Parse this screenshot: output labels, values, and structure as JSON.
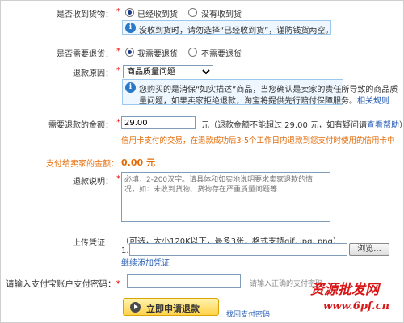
{
  "received_goods": {
    "label": "是否收到货物：",
    "required_mark": "*",
    "options": [
      "已经收到货",
      "没有收到货"
    ],
    "selected_index": 0,
    "tip": "没收到货时，请勿选择“已经收到货”，谨防钱货两空。"
  },
  "need_return": {
    "label": "是否需要退货：",
    "required_mark": "*",
    "options": [
      "我需要退货",
      "不需要退货"
    ],
    "selected_index": 0
  },
  "reason": {
    "label": "退款原因：",
    "required_mark": "*",
    "selected": "商品质量问题",
    "tip_line1": "您购买的是消保“如实描述”商品，当您确认是卖家的责任所导致的商品质",
    "tip_line2": "量问题，如果卖家拒绝退款，淘宝将提供先行赔付保障服务。",
    "tip_link": "相关规则"
  },
  "refund_amount": {
    "label": "需要退款的金额：",
    "required_mark": "*",
    "value": "29.00",
    "unit": "元",
    "hint_prefix": "（退款金额不能超过  29.00 元，如有疑问请",
    "hint_link": "查看帮助",
    "hint_suffix": "）",
    "credit_note": "信用卡支付的交易，在退款成功后3-5个工作日内退款到您支付时使用的信用卡中"
  },
  "pay_seller": {
    "label": "支付给卖家的金额：",
    "value": "0.00 元"
  },
  "description": {
    "label": "退款说明：",
    "required_mark": "*",
    "placeholder": "必填，2-200汉字。请具体和如实地说明要求卖家退款的情况，如：未收到货物、货物存在严重质量问题等"
  },
  "upload": {
    "label": "上传凭证：",
    "hint": "（可选，大小120K以下，最多3张，格式支持gif, jpg, png）",
    "index": "1.",
    "browse_label": "浏览...",
    "add_more": "继续添加凭证"
  },
  "password": {
    "label": "请输入支付宝账户支付密码：",
    "required_mark": "*",
    "hint": "请输入正确的支付密码"
  },
  "actions": {
    "submit": "立即申请退款",
    "forgot": "找回支付密码"
  },
  "watermark": {
    "text": "资源批发网",
    "url": "www.6pf.cn"
  },
  "colors": {
    "required": "#ee0000",
    "link": "#2a5fb4",
    "note": "#e36c09",
    "tip_bg": "#eef7ff",
    "tip_border": "#9cc6ea",
    "watermark": "#d81818"
  }
}
